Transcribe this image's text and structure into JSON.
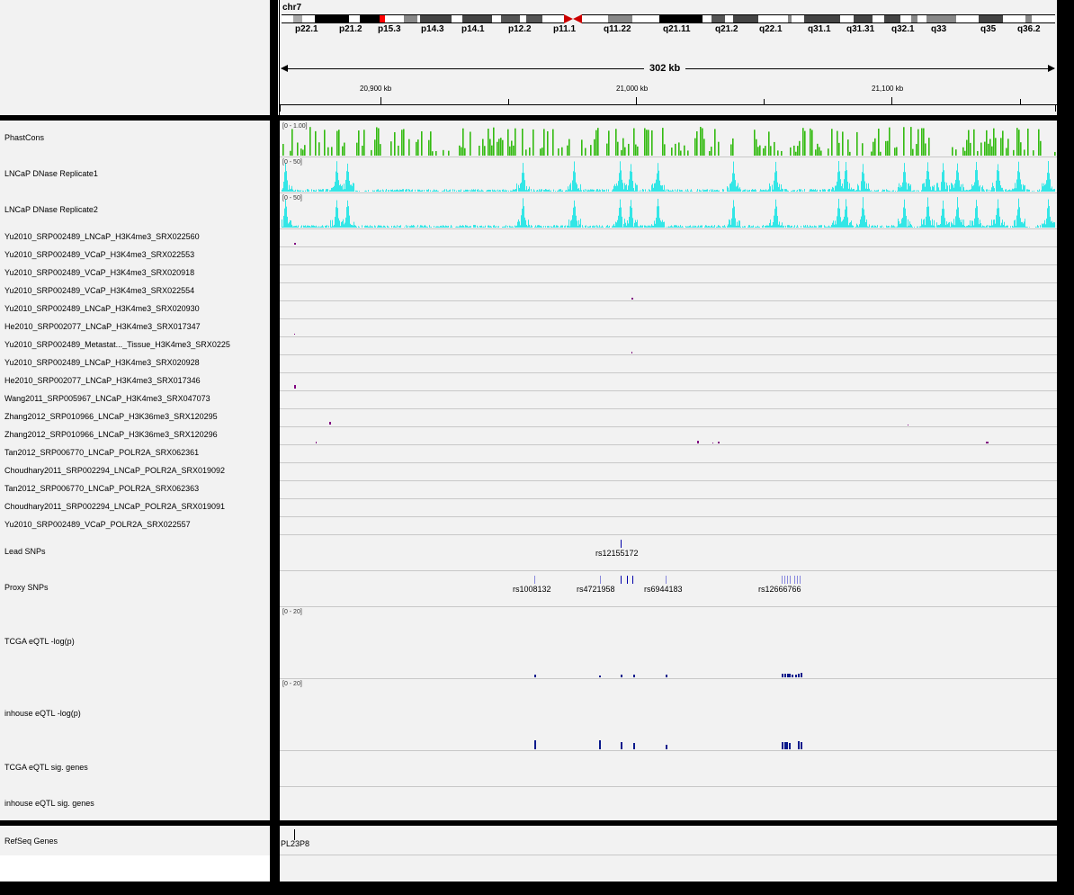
{
  "chromosome": {
    "name": "chr7",
    "band_labels": [
      "p22.1",
      "p21.2",
      "p15.3",
      "p14.3",
      "p14.1",
      "p12.2",
      "p11.1",
      "q11.22",
      "q21.11",
      "q21.2",
      "q22.1",
      "q31.1",
      "q31.31",
      "q32.1",
      "q33",
      "q35",
      "q36.2"
    ]
  },
  "ruler": {
    "span_label": "302 kb",
    "ticks": [
      "20,900 kb",
      "21,000 kb",
      "21,100 kb"
    ]
  },
  "tracks": [
    {
      "name": "PhastCons",
      "range": "[0 - 1.00]"
    },
    {
      "name": "LNCaP DNase Replicate1",
      "range": "[0 - 50]"
    },
    {
      "name": "LNCaP DNase Replicate2",
      "range": "[0 - 50]"
    },
    {
      "name": "Yu2010_SRP002489_LNCaP_H3K4me3_SRX022560"
    },
    {
      "name": "Yu2010_SRP002489_VCaP_H3K4me3_SRX022553"
    },
    {
      "name": "Yu2010_SRP002489_VCaP_H3K4me3_SRX020918"
    },
    {
      "name": "Yu2010_SRP002489_VCaP_H3K4me3_SRX022554"
    },
    {
      "name": "Yu2010_SRP002489_LNCaP_H3K4me3_SRX020930"
    },
    {
      "name": "He2010_SRP002077_LNCaP_H3K4me3_SRX017347"
    },
    {
      "name": "Yu2010_SRP002489_Metastat..._Tissue_H3K4me3_SRX0225"
    },
    {
      "name": "Yu2010_SRP002489_LNCaP_H3K4me3_SRX020928"
    },
    {
      "name": "He2010_SRP002077_LNCaP_H3K4me3_SRX017346"
    },
    {
      "name": "Wang2011_SRP005967_LNCaP_H3K4me3_SRX047073"
    },
    {
      "name": "Zhang2012_SRP010966_LNCaP_H3K36me3_SRX120295"
    },
    {
      "name": "Zhang2012_SRP010966_LNCaP_H3K36me3_SRX120296"
    },
    {
      "name": "Tan2012_SRP006770_LNCaP_POLR2A_SRX062361"
    },
    {
      "name": "Choudhary2011_SRP002294_LNCaP_POLR2A_SRX019092"
    },
    {
      "name": "Tan2012_SRP006770_LNCaP_POLR2A_SRX062363"
    },
    {
      "name": "Choudhary2011_SRP002294_LNCaP_POLR2A_SRX019091"
    },
    {
      "name": "Yu2010_SRP002489_VCaP_POLR2A_SRX022557"
    },
    {
      "name": "Lead SNPs"
    },
    {
      "name": "Proxy SNPs"
    },
    {
      "name": "TCGA eQTL -log(p)",
      "range": "[0 - 20]"
    },
    {
      "name": "inhouse eQTL -log(p)",
      "range": "[0 - 20]"
    },
    {
      "name": "TCGA eQTL sig. genes"
    },
    {
      "name": "inhouse eQTL sig. genes"
    }
  ],
  "lead_snps": [
    "rs12155172"
  ],
  "proxy_snps": [
    "rs1008132",
    "rs4721958",
    "rs6944183",
    "rs12666766"
  ],
  "gene_track": {
    "name": "RefSeq Genes",
    "gene": "PL23P8"
  },
  "colors": {
    "phastcons": "#33bb11",
    "dnase": "#33e6e6",
    "chip_peak": "#800080",
    "snp": "#0000aa",
    "proxy_snp": "#8888dd",
    "eqtl": "#0a1a8c",
    "centromere": "#cc0000",
    "highlight": "#ff0000"
  }
}
